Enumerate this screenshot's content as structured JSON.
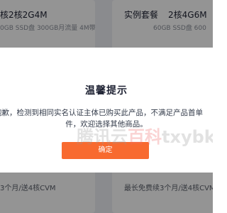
{
  "cards": {
    "left": {
      "title_prefix": "核",
      "title_spec": "2核2G4M",
      "desc": "0GB SSD盘 300GB月流量 4M带",
      "promo": "3个月/送4核CVM"
    },
    "right": {
      "title_label": "实例套餐",
      "title_spec": "2核4G6M",
      "desc": "60GB SSD盘 600",
      "promo": "最长免费续3个月/送4核CVM"
    }
  },
  "dialog": {
    "title": "温馨提示",
    "message_line1": "抱歉，检测到相同实名认证主体已购买此产品，不满足产品首单",
    "message_line2": "件，欢迎选择其他商品。",
    "confirm_label": "确定"
  },
  "watermark": {
    "prefix": "腾讯云",
    "accent": "百科",
    "suffix": "txybk.com"
  }
}
